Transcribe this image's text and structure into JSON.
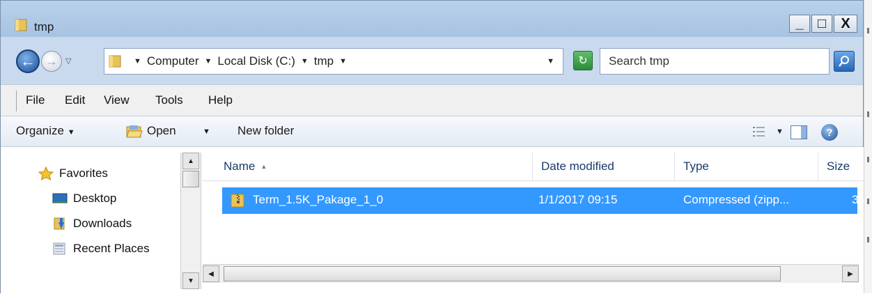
{
  "window": {
    "title": "tmp"
  },
  "title_buttons": {
    "minimize": "_",
    "maximize": "□",
    "close": "X"
  },
  "address": {
    "crumbs": [
      "Computer",
      "Local Disk (C:)",
      "tmp"
    ],
    "search_placeholder": "Search tmp"
  },
  "menu": [
    "File",
    "Edit",
    "View",
    "Tools",
    "Help"
  ],
  "toolbar": {
    "organize": "Organize",
    "open": "Open",
    "new_folder": "New folder"
  },
  "nav": {
    "favorites": "Favorites",
    "items": [
      "Desktop",
      "Downloads",
      "Recent Places"
    ]
  },
  "columns": {
    "name": "Name",
    "date": "Date modified",
    "type": "Type",
    "size": "Size"
  },
  "files": [
    {
      "name": "Term_1.5K_Pakage_1_0",
      "date": "1/1/2017 09:15",
      "type": "Compressed (zipp...",
      "size": "3"
    }
  ],
  "colors": {
    "selection": "#3399ff",
    "titlebar": "#b9d1ea",
    "accent_blue": "#1c4f94"
  },
  "icons": {
    "title": "folder-icon",
    "back": "back-arrow-icon",
    "forward": "forward-arrow-icon",
    "refresh": "refresh-icon",
    "search": "search-icon",
    "open": "open-folder-icon",
    "views": "views-icon",
    "preview": "preview-pane-icon",
    "help": "help-icon",
    "favorites": "star-icon",
    "desktop": "desktop-icon",
    "downloads": "downloads-icon",
    "recent": "recent-places-icon",
    "file": "zip-folder-icon"
  }
}
